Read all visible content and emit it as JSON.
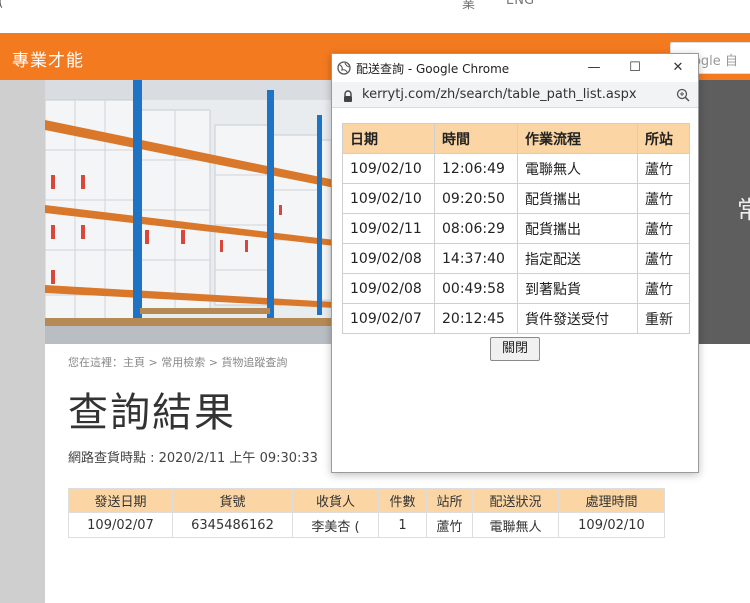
{
  "top_nav": {
    "item1_partial": "業",
    "item2_partial": "ENG"
  },
  "header": {
    "brand": "專業才能",
    "search_placeholder": "oogle 自"
  },
  "hero": {
    "side_text": "常"
  },
  "breadcrumb": "您在這裡：主頁 > 常用檢索 > 貨物追蹤查詢",
  "page_title": "查詢結果",
  "query_time": "網路查貨時點 : 2020/2/11 上午 09:30:33",
  "result_table": {
    "headers": [
      "發送日期",
      "貨號",
      "收貨人",
      "件數",
      "站所",
      "配送狀況",
      "處理時間"
    ],
    "row": [
      "109/02/07",
      "6345486162",
      "李美杏 (",
      "1",
      "蘆竹",
      "電聯無人",
      "109/02/10"
    ]
  },
  "popup": {
    "window_title": "配送查詢 - Google Chrome",
    "url": "kerrytj.com/zh/search/table_path_list.aspx",
    "minimize": "—",
    "maximize": "☐",
    "close": "✕",
    "close_button_label": "關閉",
    "table": {
      "headers": [
        "日期",
        "時間",
        "作業流程",
        "所站"
      ],
      "rows": [
        [
          "109/02/10",
          "12:06:49",
          "電聯無人",
          "蘆竹"
        ],
        [
          "109/02/10",
          "09:20:50",
          "配貨攜出",
          "蘆竹"
        ],
        [
          "109/02/11",
          "08:06:29",
          "配貨攜出",
          "蘆竹"
        ],
        [
          "109/02/08",
          "14:37:40",
          "指定配送",
          "蘆竹"
        ],
        [
          "109/02/08",
          "00:49:58",
          "到著點貨",
          "蘆竹"
        ],
        [
          "109/02/07",
          "20:12:45",
          "貨件發送受付",
          "重新"
        ]
      ]
    }
  },
  "colors": {
    "brand_orange": "#f47a20",
    "table_header": "#fbd6a4"
  }
}
